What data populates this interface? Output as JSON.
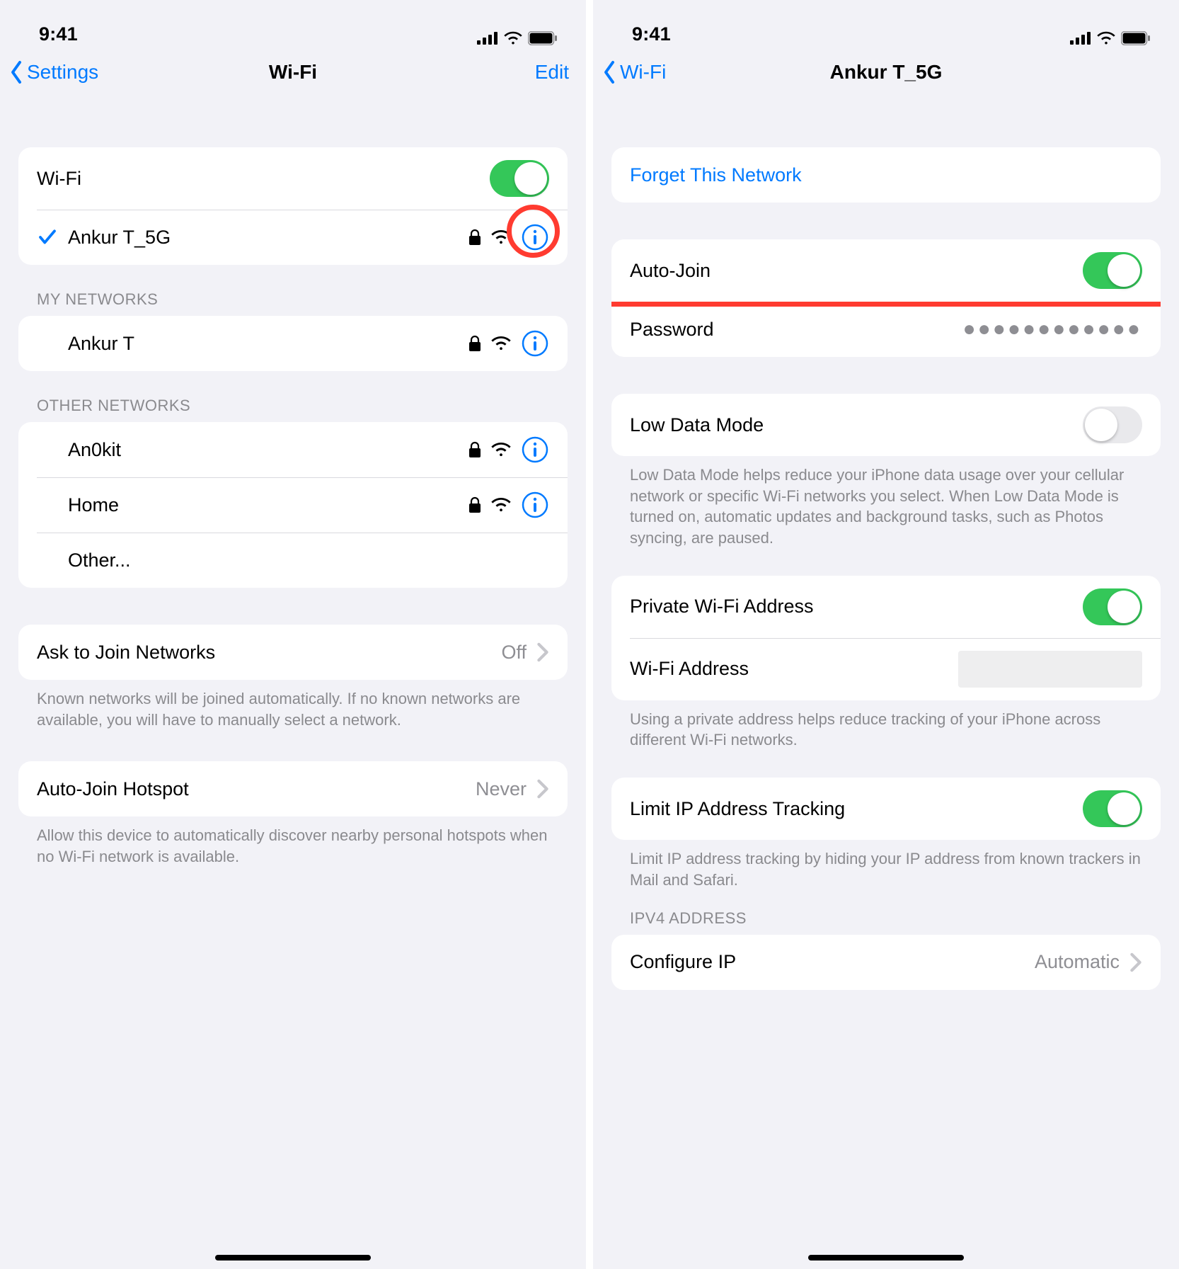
{
  "status": {
    "time": "9:41"
  },
  "left": {
    "nav": {
      "back": "Settings",
      "title": "Wi-Fi",
      "edit": "Edit"
    },
    "section1": {
      "wifi_label": "Wi-Fi",
      "connected_name": "Ankur T_5G"
    },
    "my_networks_header": "MY NETWORKS",
    "my_networks": [
      {
        "name": "Ankur T"
      }
    ],
    "other_networks_header": "OTHER NETWORKS",
    "other_networks": [
      {
        "name": "An0kit"
      },
      {
        "name": "Home"
      },
      {
        "name": "Other..."
      }
    ],
    "ask_join": {
      "label": "Ask to Join Networks",
      "value": "Off"
    },
    "ask_join_footer": "Known networks will be joined automatically. If no known networks are available, you will have to manually select a network.",
    "auto_join_hotspot": {
      "label": "Auto-Join Hotspot",
      "value": "Never"
    },
    "auto_join_footer": "Allow this device to automatically discover nearby personal hotspots when no Wi-Fi network is available."
  },
  "right": {
    "nav": {
      "back": "Wi-Fi",
      "title": "Ankur T_5G"
    },
    "forget_label": "Forget This Network",
    "auto_join_label": "Auto-Join",
    "password_label": "Password",
    "password_value": "●●●●●●●●●●●●",
    "low_data_label": "Low Data Mode",
    "low_data_footer": "Low Data Mode helps reduce your iPhone data usage over your cellular network or specific Wi-Fi networks you select. When Low Data Mode is turned on, automatic updates and background tasks, such as Photos syncing, are paused.",
    "private_addr_label": "Private Wi-Fi Address",
    "wifi_addr_label": "Wi-Fi Address",
    "private_footer": "Using a private address helps reduce tracking of your iPhone across different Wi-Fi networks.",
    "limit_tracking_label": "Limit IP Address Tracking",
    "limit_tracking_footer": "Limit IP address tracking by hiding your IP address from known trackers in Mail and Safari.",
    "ipv4_header": "IPV4 ADDRESS",
    "configure_ip": {
      "label": "Configure IP",
      "value": "Automatic"
    }
  }
}
